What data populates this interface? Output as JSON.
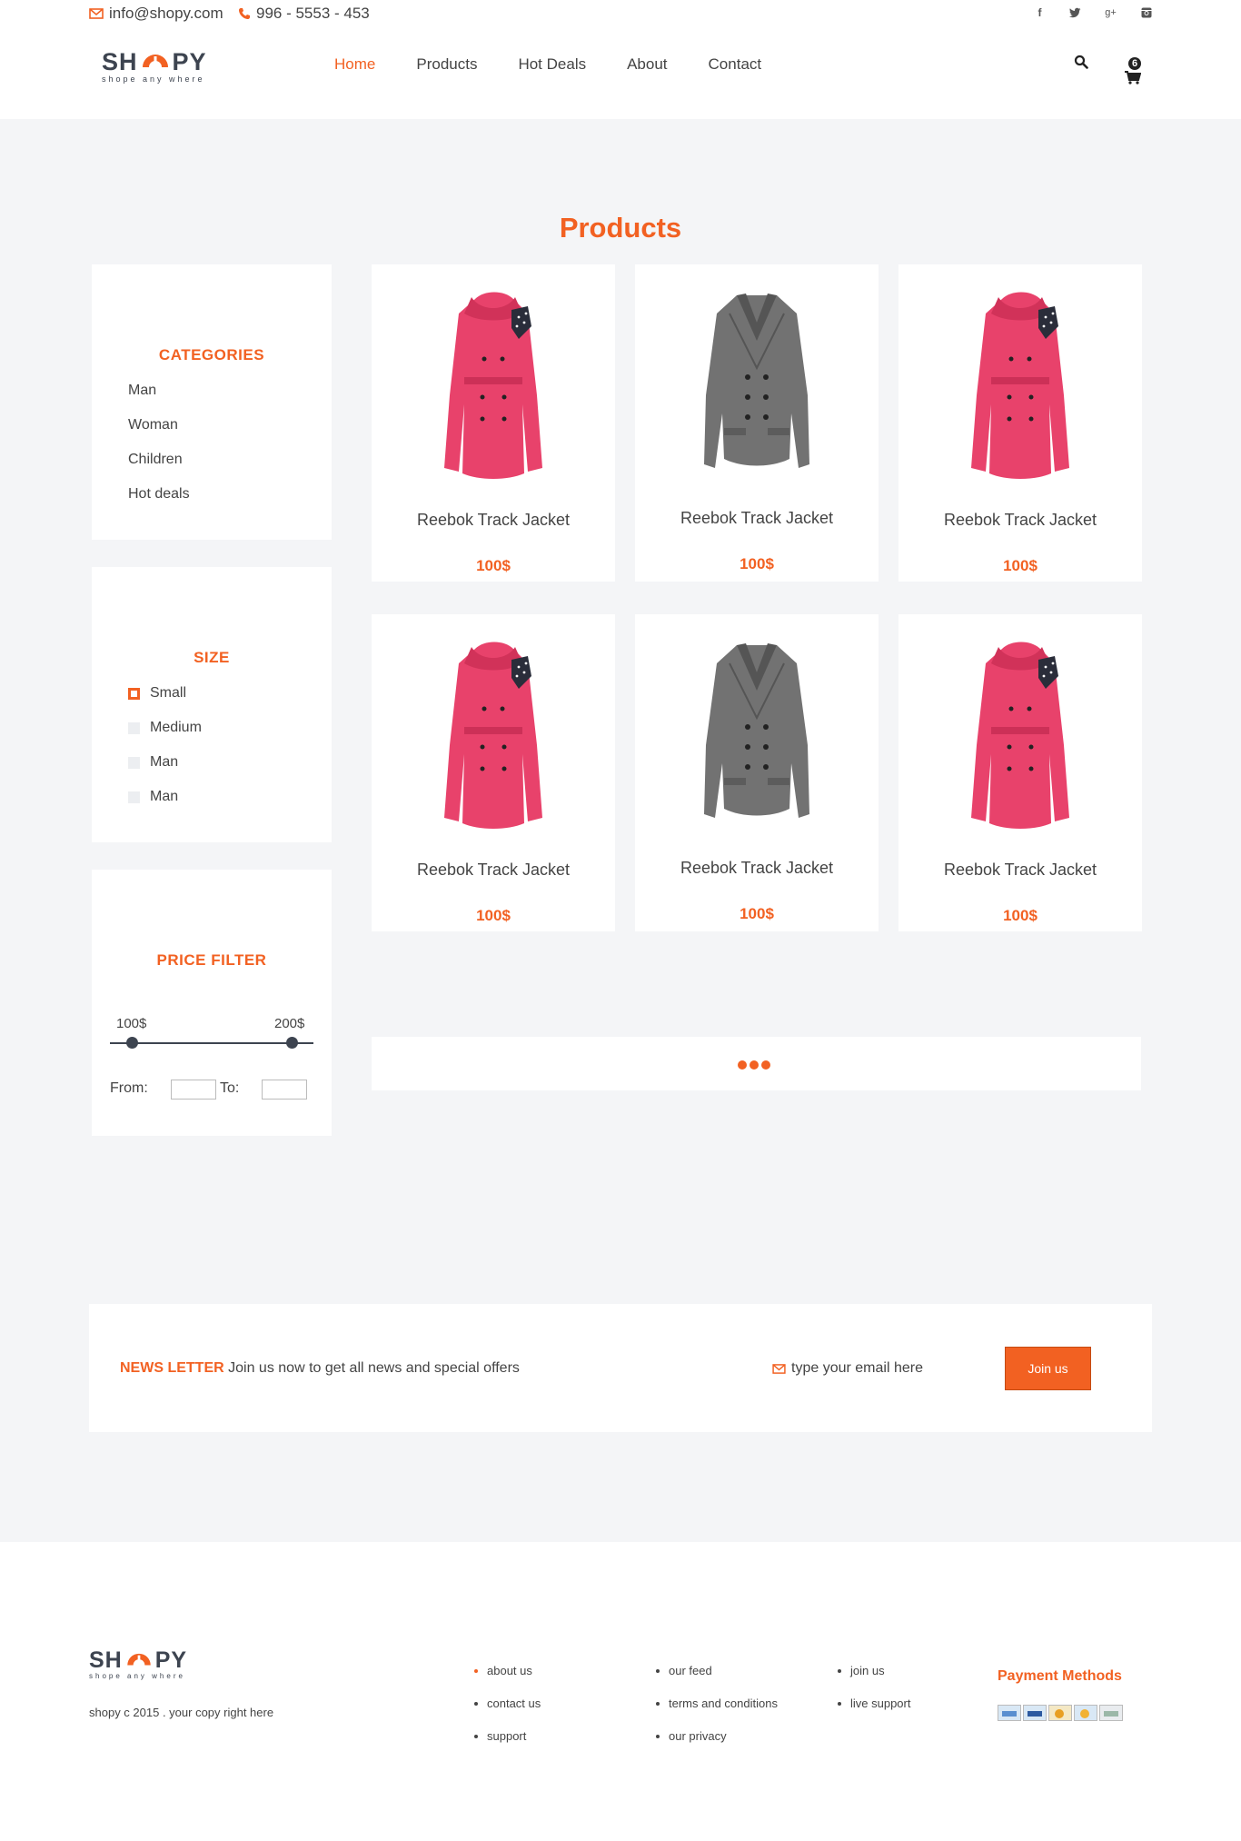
{
  "topbar": {
    "email": "info@shopy.com",
    "phone": "996 - 5553 - 453",
    "socials": [
      {
        "icon": "facebook-icon",
        "glyph": "f"
      },
      {
        "icon": "twitter-icon",
        "glyph": "t"
      },
      {
        "icon": "google-plus-icon",
        "glyph": "g+"
      },
      {
        "icon": "instagram-icon",
        "glyph": "◙"
      }
    ]
  },
  "brand": {
    "logo_left": "SH",
    "logo_right": "PY",
    "tagline": "shope any where"
  },
  "nav": {
    "items": [
      "Home",
      "Products",
      "Hot Deals",
      "About",
      "Contact"
    ],
    "active": "Home"
  },
  "cart": {
    "count": "6"
  },
  "page": {
    "title": "Products"
  },
  "categories": {
    "title": "CATEGORIES",
    "items": [
      "Man",
      "Woman",
      "Children",
      "Hot deals"
    ]
  },
  "size": {
    "title": "SIZE",
    "items": [
      "Small",
      "Medium",
      "Man",
      "Man"
    ],
    "selected": "Small"
  },
  "price_filter": {
    "title": "PRICE FILTER",
    "min_label": "100$",
    "max_label": "200$",
    "from_label": "From:",
    "to_label": "To:"
  },
  "products": [
    {
      "name": "Reebok Track Jacket",
      "price": "100$",
      "image": "pink-coat"
    },
    {
      "name": "Reebok Track Jacket",
      "price": "100$",
      "image": "gray-coat"
    },
    {
      "name": "Reebok Track Jacket",
      "price": "100$",
      "image": "pink-coat"
    },
    {
      "name": "Reebok Track Jacket",
      "price": "100$",
      "image": "pink-coat"
    },
    {
      "name": "Reebok Track Jacket",
      "price": "100$",
      "image": "gray-coat"
    },
    {
      "name": "Reebok Track Jacket",
      "price": "100$",
      "image": "pink-coat"
    }
  ],
  "newsletter": {
    "title": "NEWS LETTER",
    "text": "Join us now to get all news and special offers",
    "placeholder": "type your email here",
    "button": "Join us"
  },
  "footer": {
    "copyright": "shopy c 2015 . your copy right here",
    "links_col1": [
      "about us",
      "contact us",
      "support"
    ],
    "links_col2": [
      "our feed",
      "terms and conditions",
      "our privacy"
    ],
    "links_col3": [
      "join us",
      "live support"
    ],
    "payment_title": "Payment Methods"
  },
  "colors": {
    "accent": "#f26122",
    "dark": "#3d4450",
    "background": "#f4f5f7",
    "pink_coat": "#e8426b",
    "gray_coat": "#707070"
  }
}
